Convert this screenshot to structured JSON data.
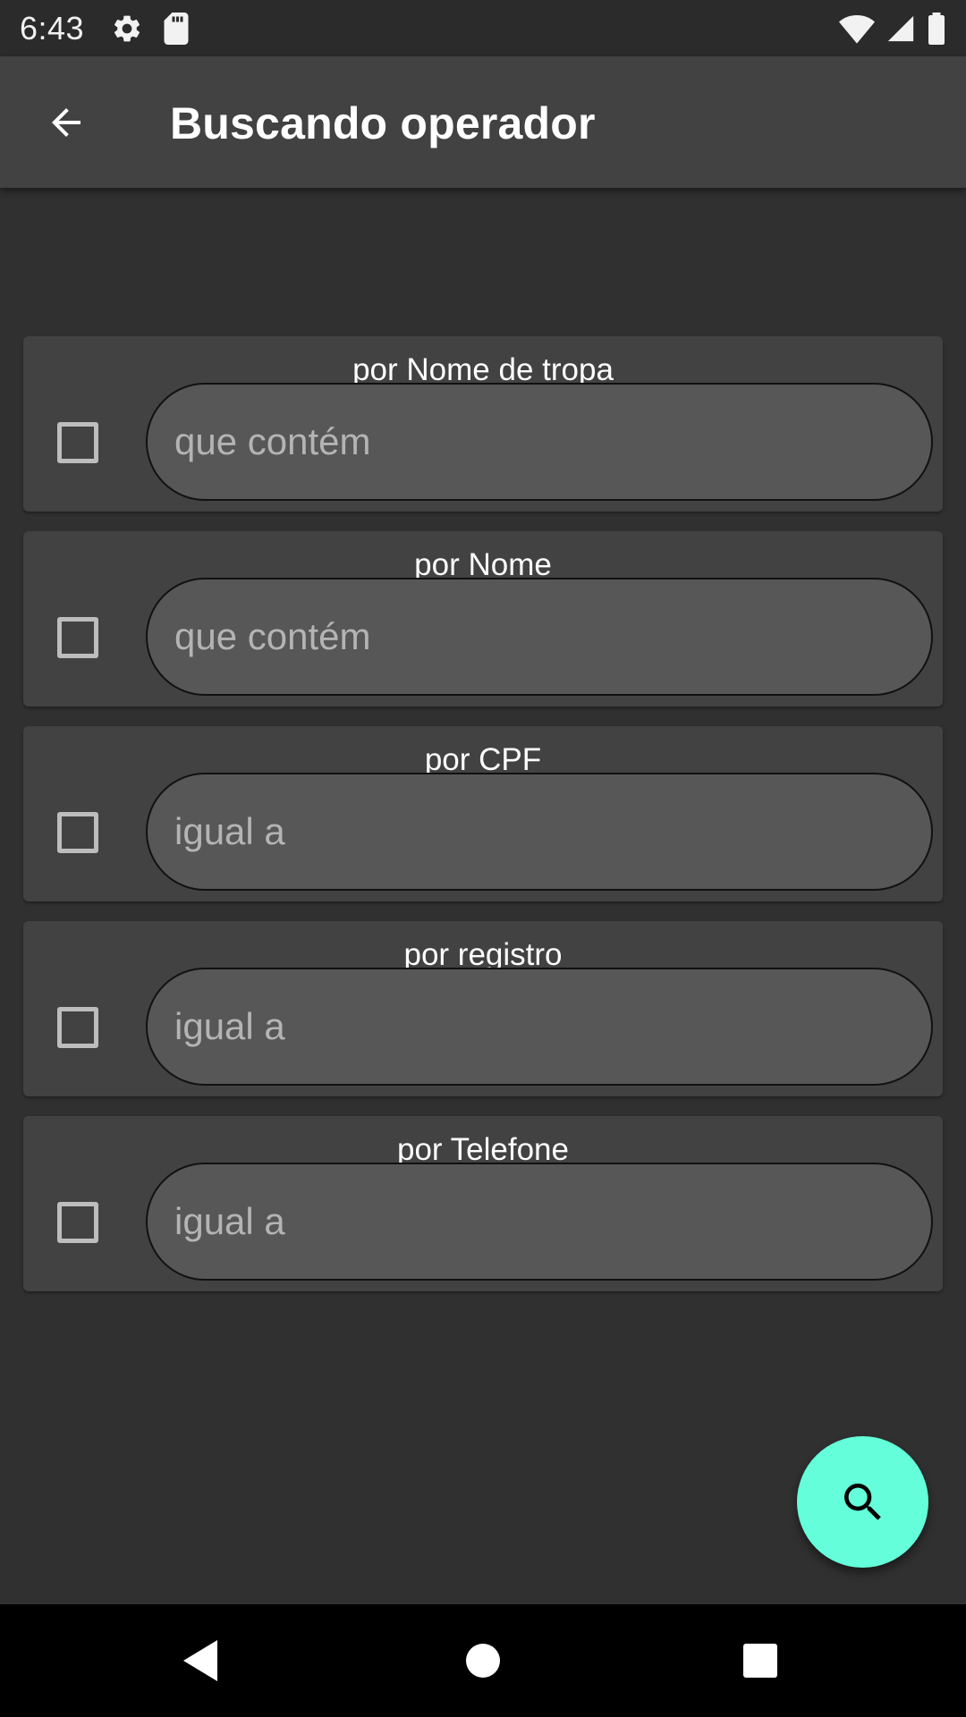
{
  "status_bar": {
    "time": "6:43",
    "left_icons": [
      "settings-icon",
      "sd-card-icon"
    ],
    "right_icons": [
      "wifi-icon",
      "signal-icon",
      "battery-icon"
    ]
  },
  "app_bar": {
    "back_icon": "arrow-back-icon",
    "title": "Buscando operador"
  },
  "filters": [
    {
      "title": "por Nome de tropa",
      "placeholder": "que contém",
      "value": "",
      "checked": false
    },
    {
      "title": "por Nome",
      "placeholder": "que contém",
      "value": "",
      "checked": false
    },
    {
      "title": "por CPF",
      "placeholder": "igual a",
      "value": "",
      "checked": false
    },
    {
      "title": "por registro",
      "placeholder": "igual a",
      "value": "",
      "checked": false
    },
    {
      "title": "por Telefone",
      "placeholder": "igual a",
      "value": "",
      "checked": false
    }
  ],
  "fab": {
    "icon": "search-icon",
    "color": "#64ffda"
  },
  "nav_bar": {
    "icons": [
      "nav-back-icon",
      "nav-home-icon",
      "nav-recents-icon"
    ]
  },
  "colors": {
    "background": "#303030",
    "app_bar": "#424242",
    "card": "#424242",
    "field": "#575757",
    "accent": "#64ffda"
  }
}
